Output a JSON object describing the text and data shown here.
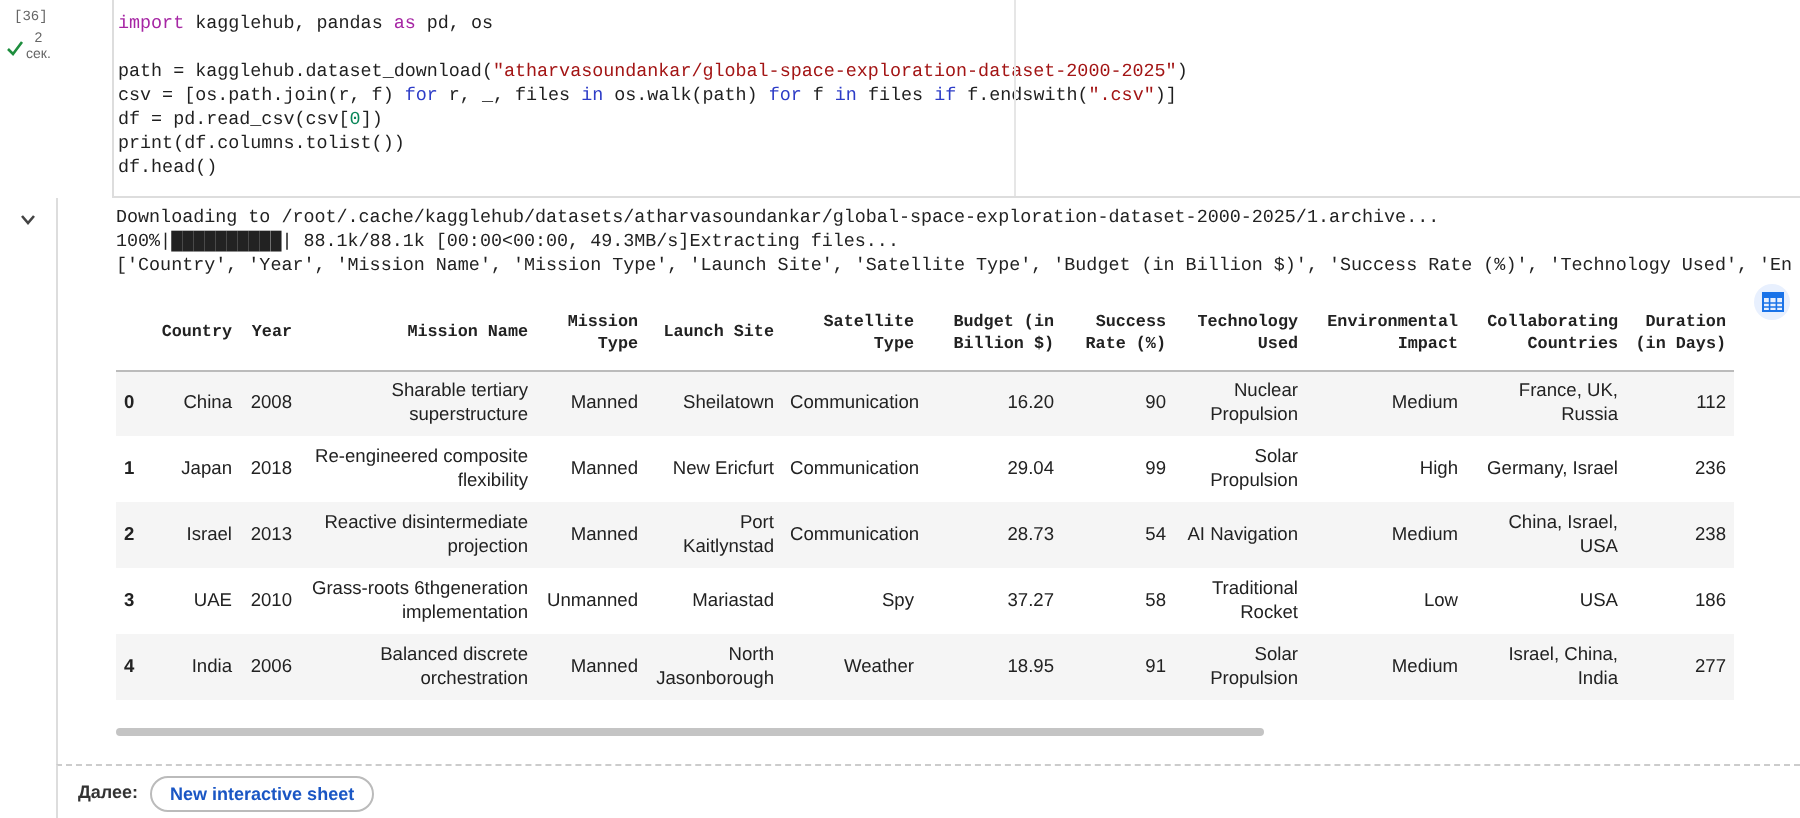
{
  "cell": {
    "execution_count": "[36]",
    "duration": "2",
    "duration_unit": "сек.",
    "code_lines": [
      {
        "kind": "code",
        "tokens": [
          {
            "kind": "keyword",
            "text": "import"
          },
          {
            "kind": "plain",
            "text": " kagglehub, pandas "
          },
          {
            "kind": "keyword",
            "text": "as"
          },
          {
            "kind": "plain",
            "text": " pd, os"
          }
        ]
      },
      {
        "kind": "blank"
      },
      {
        "kind": "code",
        "tokens": [
          {
            "kind": "plain",
            "text": "path = kagglehub.dataset_download("
          },
          {
            "kind": "string",
            "text": "\"atharvasoundankar/global-space-exploration-dataset-2000-2025\""
          },
          {
            "kind": "plain",
            "text": ")"
          }
        ]
      },
      {
        "kind": "code",
        "tokens": [
          {
            "kind": "plain",
            "text": "csv = [os.path.join(r, f) "
          },
          {
            "kind": "control",
            "text": "for"
          },
          {
            "kind": "plain",
            "text": " r, _, files "
          },
          {
            "kind": "control",
            "text": "in"
          },
          {
            "kind": "plain",
            "text": " os.walk(path) "
          },
          {
            "kind": "control",
            "text": "for"
          },
          {
            "kind": "plain",
            "text": " f "
          },
          {
            "kind": "control",
            "text": "in"
          },
          {
            "kind": "plain",
            "text": " files "
          },
          {
            "kind": "control",
            "text": "if"
          },
          {
            "kind": "plain",
            "text": " f.endswith("
          },
          {
            "kind": "string",
            "text": "\".csv\""
          },
          {
            "kind": "plain",
            "text": ")]"
          }
        ]
      },
      {
        "kind": "code",
        "tokens": [
          {
            "kind": "plain",
            "text": "df = pd.read_csv(csv["
          },
          {
            "kind": "number",
            "text": "0"
          },
          {
            "kind": "plain",
            "text": "])"
          }
        ]
      },
      {
        "kind": "code",
        "tokens": [
          {
            "kind": "plain",
            "text": "print(df.columns.tolist())"
          }
        ]
      },
      {
        "kind": "code",
        "tokens": [
          {
            "kind": "plain",
            "text": "df.head()"
          }
        ]
      }
    ]
  },
  "output": {
    "expanded": true,
    "stream_lines": [
      "Downloading to /root/.cache/kagglehub/datasets/atharvasoundankar/global-space-exploration-dataset-2000-2025/1.archive...",
      "100%|██████████| 88.1k/88.1k [00:00<00:00, 49.3MB/s]Extracting files...",
      "['Country', 'Year', 'Mission Name', 'Mission Type', 'Launch Site', 'Satellite Type', 'Budget (in Billion $)', 'Success Rate (%)', 'Technology Used', 'En"
    ],
    "table": {
      "columns": [
        "Country",
        "Year",
        "Mission Name",
        "Mission Type",
        "Launch Site",
        "Satellite Type",
        "Budget (in Billion $)",
        "Success Rate (%)",
        "Technology Used",
        "Environmental Impact",
        "Collaborating Countries",
        "Duration (in Days)"
      ],
      "rows": [
        {
          "index": "0",
          "cells": [
            "China",
            "2008",
            "Sharable tertiary superstructure",
            "Manned",
            "Sheilatown",
            "Communication",
            "16.20",
            "90",
            "Nuclear Propulsion",
            "Medium",
            "France, UK, Russia",
            "112"
          ]
        },
        {
          "index": "1",
          "cells": [
            "Japan",
            "2018",
            "Re-engineered composite flexibility",
            "Manned",
            "New Ericfurt",
            "Communication",
            "29.04",
            "99",
            "Solar Propulsion",
            "High",
            "Germany, Israel",
            "236"
          ]
        },
        {
          "index": "2",
          "cells": [
            "Israel",
            "2013",
            "Reactive disintermediate projection",
            "Manned",
            "Port Kaitlynstad",
            "Communication",
            "28.73",
            "54",
            "AI Navigation",
            "Medium",
            "China, Israel, USA",
            "238"
          ]
        },
        {
          "index": "3",
          "cells": [
            "UAE",
            "2010",
            "Grass-roots 6thgeneration implementation",
            "Unmanned",
            "Mariastad",
            "Spy",
            "37.27",
            "58",
            "Traditional Rocket",
            "Low",
            "USA",
            "186"
          ]
        },
        {
          "index": "4",
          "cells": [
            "India",
            "2006",
            "Balanced discrete orchestration",
            "Manned",
            "North Jasonborough",
            "Weather",
            "18.95",
            "91",
            "Solar Propulsion",
            "Medium",
            "Israel, China, India",
            "277"
          ]
        }
      ]
    }
  },
  "footer": {
    "label": "Далее:",
    "button": "New interactive sheet"
  }
}
